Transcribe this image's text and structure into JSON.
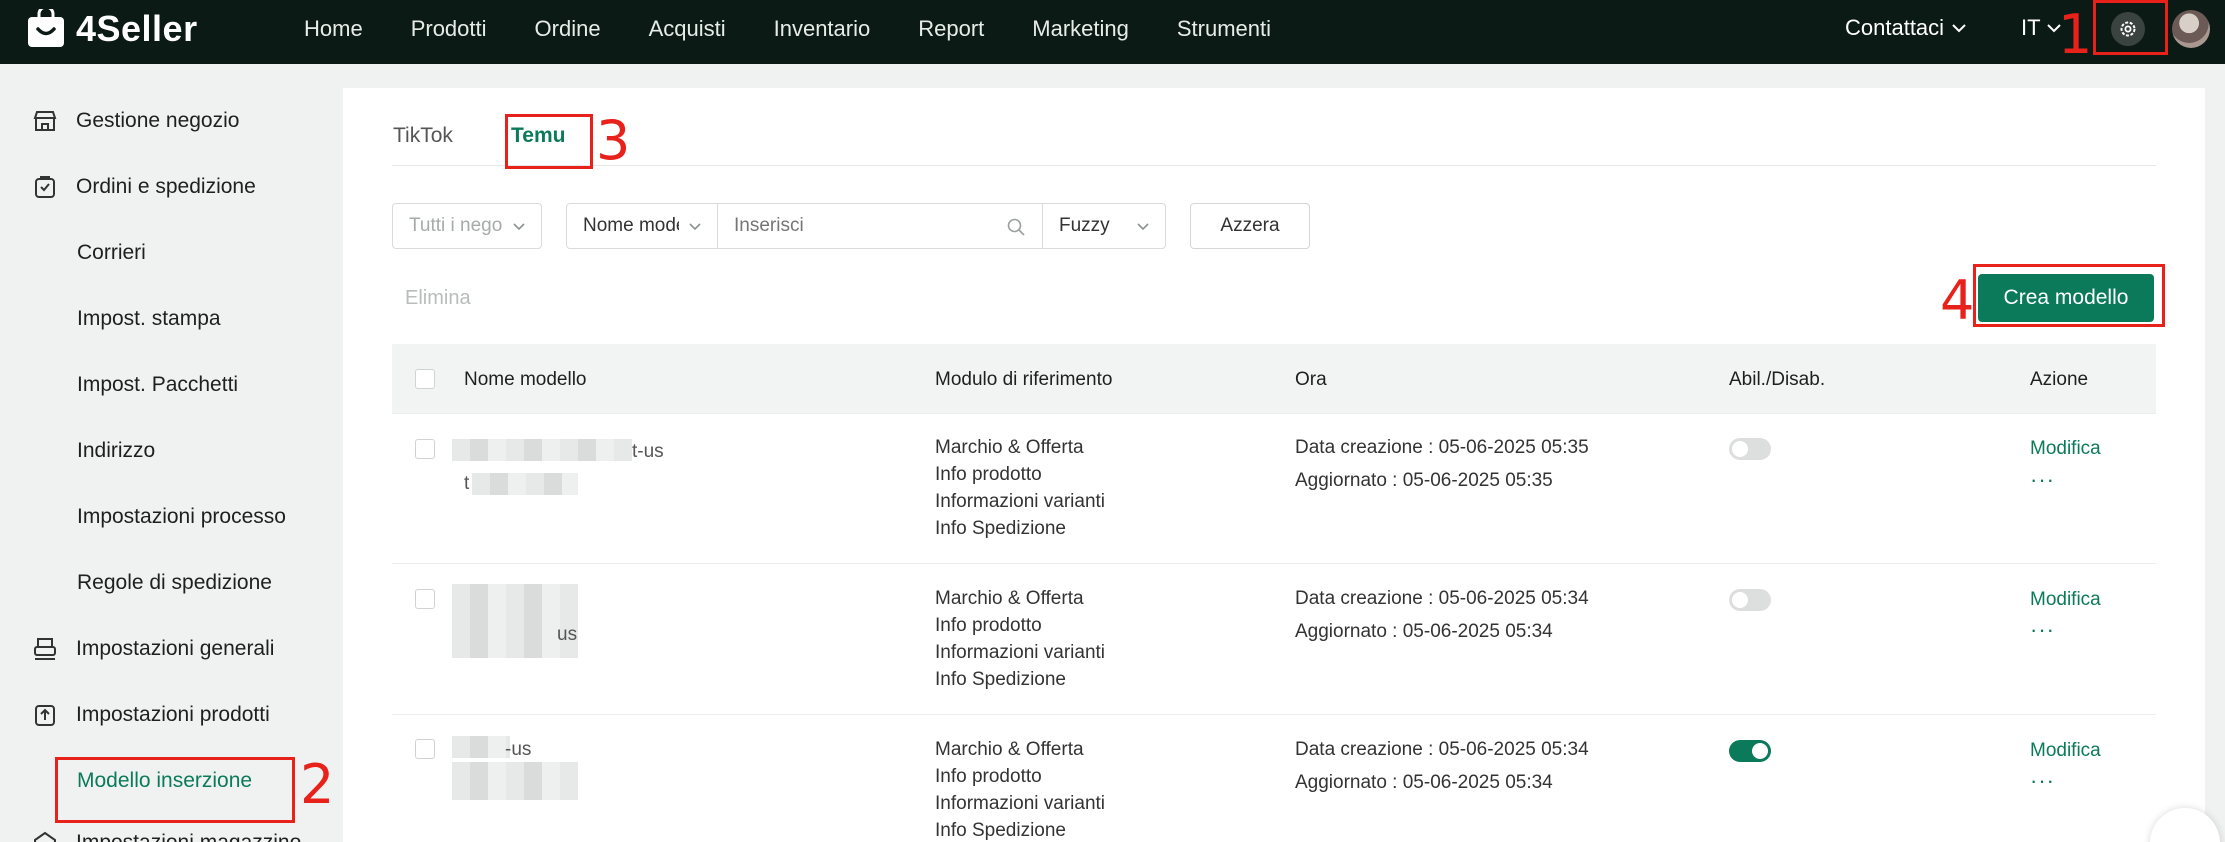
{
  "brand": {
    "name": "4Seller"
  },
  "nav": {
    "items": [
      "Home",
      "Prodotti",
      "Ordine",
      "Acquisti",
      "Inventario",
      "Report",
      "Marketing",
      "Strumenti"
    ],
    "contact": "Contattaci",
    "language": "IT"
  },
  "sidebar": {
    "groups": [
      {
        "label": "Gestione negozio",
        "icon": "store-icon"
      },
      {
        "label": "Ordini e spedizione",
        "icon": "order-icon"
      }
    ],
    "order_subitems": [
      "Corrieri",
      "Impost. stampa",
      "Impost. Pacchetti",
      "Indirizzo",
      "Impostazioni processo",
      "Regole di spedizione"
    ],
    "general": {
      "label": "Impostazioni generali",
      "icon": "printer-icon"
    },
    "products": {
      "label": "Impostazioni prodotti",
      "icon": "upload-box-icon"
    },
    "active_subitem": "Modello inserzione",
    "next_partial": "Impostazioni magazzino"
  },
  "tabs": {
    "tiktok": "TikTok",
    "temu": "Temu"
  },
  "filters": {
    "store_placeholder": "Tutti i negozi",
    "field_select": "Nome modello",
    "search_placeholder": "Inserisci",
    "match_mode": "Fuzzy",
    "reset": "Azzera"
  },
  "actions": {
    "delete": "Elimina",
    "create": "Crea modello"
  },
  "table": {
    "headers": [
      "Nome modello",
      "Modulo di riferimento",
      "Ora",
      "Abil./Disab.",
      "Azione"
    ],
    "rows": [
      {
        "name_suffix": "t-us",
        "name_prefix2": "t",
        "modules": [
          "Marchio & Offerta",
          "Info prodotto",
          "Informazioni varianti",
          "Info Spedizione"
        ],
        "created": "Data creazione : 05-06-2025 05:35",
        "updated": "Aggiornato : 05-06-2025 05:35",
        "enabled": false,
        "action": "Modifica",
        "more": "···"
      },
      {
        "name_suffix": "us",
        "name_prefix2": "",
        "modules": [
          "Marchio & Offerta",
          "Info prodotto",
          "Informazioni varianti",
          "Info Spedizione"
        ],
        "created": "Data creazione : 05-06-2025 05:34",
        "updated": "Aggiornato : 05-06-2025 05:34",
        "enabled": false,
        "action": "Modifica",
        "more": "···"
      },
      {
        "name_suffix": "-us",
        "name_prefix2": "",
        "modules": [
          "Marchio & Offerta",
          "Info prodotto",
          "Informazioni varianti",
          "Info Spedizione"
        ],
        "created": "Data creazione : 05-06-2025 05:34",
        "updated": "Aggiornato : 05-06-2025 05:34",
        "enabled": true,
        "action": "Modifica",
        "more": "···"
      }
    ]
  },
  "annotations": [
    "1",
    "2",
    "3",
    "4"
  ],
  "colors": {
    "accent": "#0b7a5b",
    "topbar": "#0b1a15",
    "annotation": "#e8211a"
  }
}
